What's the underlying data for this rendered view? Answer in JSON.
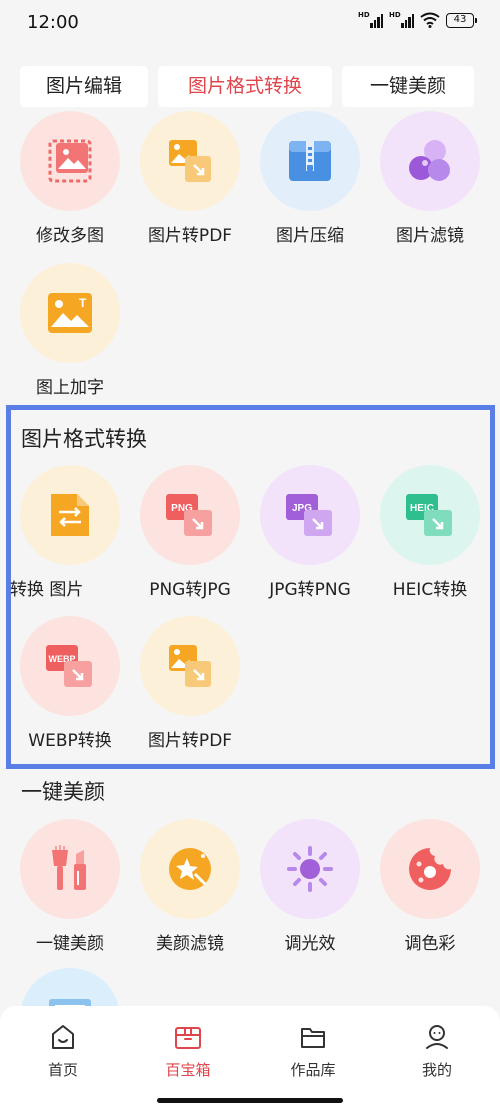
{
  "status": {
    "time": "12:00",
    "network_tag": "HD",
    "battery": "43"
  },
  "tabs": [
    {
      "label": "图片编辑"
    },
    {
      "label": "图片格式转换"
    },
    {
      "label": "一键美颜"
    }
  ],
  "edit_section": {
    "items": [
      {
        "label": "修改多图",
        "icon": "multi-image-icon"
      },
      {
        "label": "图片转PDF",
        "icon": "image-to-pdf-icon"
      },
      {
        "label": "图片压缩",
        "icon": "compress-zip-icon"
      },
      {
        "label": "图片滤镜",
        "icon": "filter-circles-icon"
      },
      {
        "label": "图上加字",
        "icon": "add-text-image-icon"
      }
    ]
  },
  "format_section": {
    "title": "图片格式转换",
    "items": [
      {
        "label": "转换     图片",
        "icon": "convert-file-icon"
      },
      {
        "label": "PNG转JPG",
        "icon": "png-icon",
        "badge": "PNG"
      },
      {
        "label": "JPG转PNG",
        "icon": "jpg-icon",
        "badge": "JPG"
      },
      {
        "label": "HEIC转换",
        "icon": "heic-icon",
        "badge": "HEIC"
      },
      {
        "label": "WEBP转换",
        "icon": "webp-icon",
        "badge": "WEBP"
      },
      {
        "label": "图片转PDF",
        "icon": "image-to-pdf-icon"
      }
    ]
  },
  "beauty_section": {
    "title": "一键美颜",
    "items": [
      {
        "label": "一键美颜",
        "icon": "makeup-brush-icon"
      },
      {
        "label": "美颜滤镜",
        "icon": "magic-star-icon"
      },
      {
        "label": "调光效",
        "icon": "sun-icon"
      },
      {
        "label": "调色彩",
        "icon": "palette-icon"
      }
    ]
  },
  "bottom_nav": [
    {
      "label": "首页",
      "icon": "home-icon"
    },
    {
      "label": "百宝箱",
      "icon": "toolbox-icon",
      "active": true
    },
    {
      "label": "作品库",
      "icon": "folder-icon"
    },
    {
      "label": "我的",
      "icon": "profile-icon"
    }
  ],
  "colors": {
    "accent": "#e0454b",
    "highlight": "#5a7de6"
  }
}
